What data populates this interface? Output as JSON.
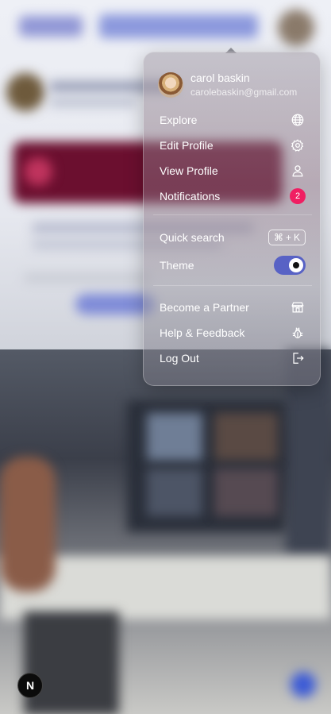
{
  "user": {
    "name": "carol baskin",
    "email": "carolebaskin@gmail.com"
  },
  "menu": {
    "items": [
      {
        "label": "Explore",
        "icon": "globe-icon"
      },
      {
        "label": "Edit Profile",
        "icon": "gear-icon"
      },
      {
        "label": "View Profile",
        "icon": "user-icon"
      },
      {
        "label": "Notifications",
        "badge": "2"
      }
    ],
    "quick_search": {
      "label": "Quick search",
      "shortcut_symbol": "⌘",
      "shortcut_plus": "+",
      "shortcut_key": "K"
    },
    "theme": {
      "label": "Theme",
      "toggle_on": true
    },
    "footer_items": [
      {
        "label": "Become a Partner",
        "icon": "store-icon"
      },
      {
        "label": "Help & Feedback",
        "icon": "bug-icon"
      },
      {
        "label": "Log Out",
        "icon": "logout-icon"
      }
    ]
  },
  "badge": {
    "letter": "N"
  },
  "colors": {
    "notification_badge": "#f01e62",
    "toggle_track": "#5862c5",
    "card_accent": "#6b0f2f",
    "fab_blue": "#3b5ad6"
  }
}
